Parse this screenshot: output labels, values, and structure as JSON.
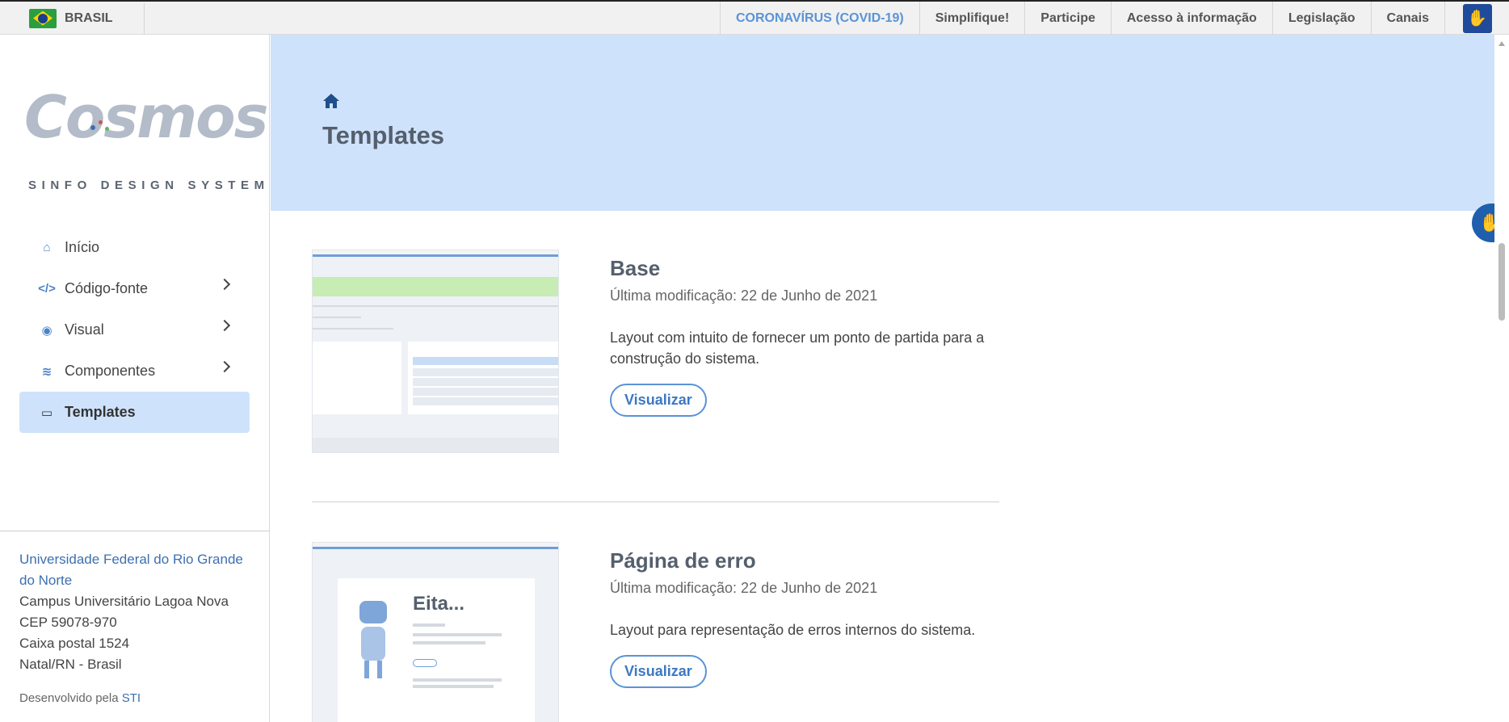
{
  "govbar": {
    "country": "BRASIL",
    "nav": [
      {
        "label": "CORONAVÍRUS (COVID-19)"
      },
      {
        "label": "Simplifique!"
      },
      {
        "label": "Participe"
      },
      {
        "label": "Acesso à informação"
      },
      {
        "label": "Legislação"
      },
      {
        "label": "Canais"
      }
    ],
    "accent": "#5a93d6"
  },
  "logo": {
    "word": "Cosmos",
    "subtitle": "SINFO DESIGN SYSTEM"
  },
  "sidebar": {
    "items": [
      {
        "label": "Início",
        "icon": "home-icon",
        "has_submenu": false
      },
      {
        "label": "Código-fonte",
        "icon": "code-icon",
        "has_submenu": true
      },
      {
        "label": "Visual",
        "icon": "palette-icon",
        "has_submenu": true
      },
      {
        "label": "Componentes",
        "icon": "layers-icon",
        "has_submenu": true
      },
      {
        "label": "Templates",
        "icon": "template-icon",
        "has_submenu": false,
        "active": true
      }
    ],
    "footer": {
      "university": "Universidade Federal do Rio Grande do Norte",
      "campus": "Campus Universitário Lagoa Nova",
      "cep": "CEP 59078-970",
      "box": "Caixa postal 1524",
      "city": "Natal/RN - Brasil",
      "developed_by": "Desenvolvido pela",
      "developer": "STI"
    }
  },
  "hero": {
    "title": "Templates",
    "background": "#cfe2fb"
  },
  "templates": [
    {
      "title": "Base",
      "modified": "Última modificação: 22 de Junho de 2021",
      "description": "Layout com intuito de fornecer um ponto de partida para a construção do sistema.",
      "button": "Visualizar"
    },
    {
      "title": "Página de erro",
      "modified": "Última modificação: 22 de Junho de 2021",
      "description": "Layout para representação de erros internos do sistema.",
      "button": "Visualizar",
      "preview_heading": "Eita..."
    }
  ]
}
